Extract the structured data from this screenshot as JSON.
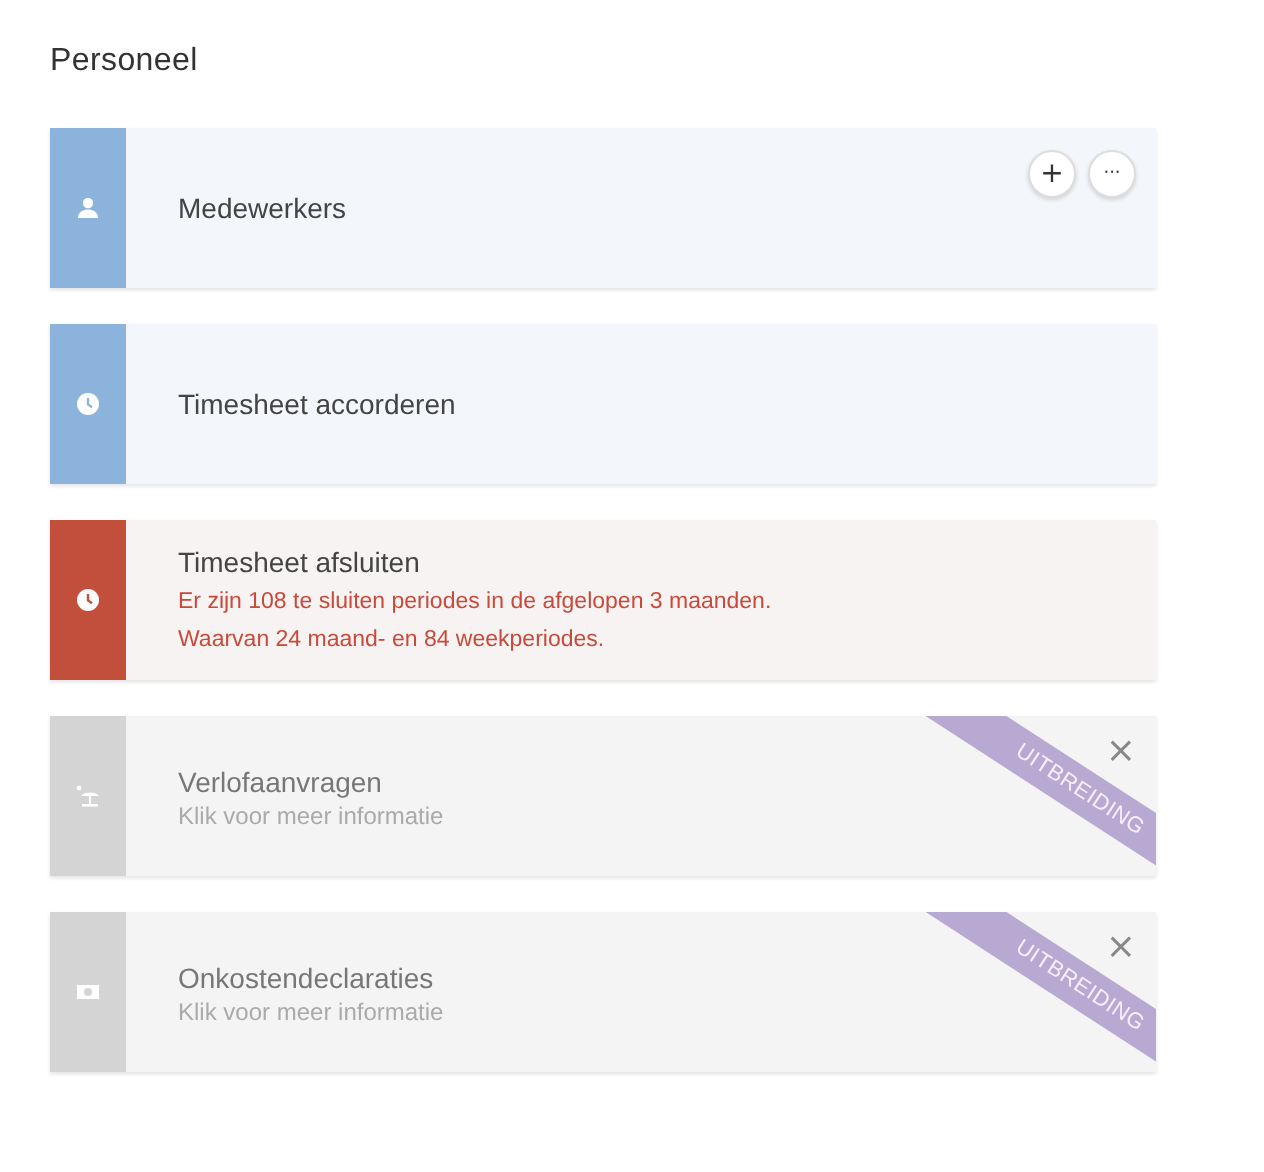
{
  "title": "Personeel",
  "cards": [
    {
      "kind": "normal",
      "title": "Medewerkers",
      "actions": [
        "+",
        "···"
      ]
    },
    {
      "kind": "normal",
      "title": "Timesheet accorderen"
    },
    {
      "kind": "alert",
      "title": "Timesheet afsluiten",
      "lines": [
        "Er zijn 108 te sluiten periodes in de afgelopen 3 maanden.",
        "Waarvan 24 maand- en 84 weekperiodes."
      ]
    },
    {
      "kind": "extension",
      "title": "Verlofaanvragen",
      "subtitle": "Klik voor meer informatie",
      "ribbon": "UITBREIDING",
      "close": "×"
    },
    {
      "kind": "extension",
      "title": "Onkostendeclaraties",
      "subtitle": "Klik voor meer informatie",
      "ribbon": "UITBREIDING",
      "close": "×"
    }
  ]
}
